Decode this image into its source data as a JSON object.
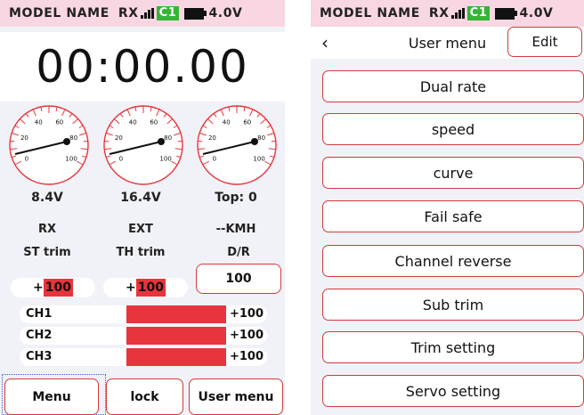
{
  "status": {
    "model_name": "MODEL NAME",
    "rx": "RX",
    "channel_badge": "C1",
    "voltage": "4.0V",
    "icons": [
      "signal-bars-icon",
      "battery-icon"
    ]
  },
  "main": {
    "timer": "00:00.00",
    "gauges": [
      {
        "reading": "8.4V",
        "label": "RX",
        "scale": [
          "0",
          "20",
          "40",
          "60",
          "80",
          "100"
        ]
      },
      {
        "reading": "16.4V",
        "label": "EXT",
        "scale": [
          "0",
          "20",
          "40",
          "60",
          "80",
          "100"
        ]
      },
      {
        "reading": "Top: 0",
        "label": "--KMH",
        "scale": [
          "0",
          "20",
          "40",
          "60",
          "80",
          "100"
        ]
      }
    ],
    "trims": {
      "st_label": "ST trim",
      "th_label": "TH trim",
      "dr_label": "D/R",
      "st_sign": "+",
      "st_value": "100",
      "th_sign": "+",
      "th_value": "100",
      "dr_value": "100"
    },
    "channels": [
      {
        "name": "CH1",
        "value": "+100",
        "level": 1.0
      },
      {
        "name": "CH2",
        "value": "+100",
        "level": 1.0
      },
      {
        "name": "CH3",
        "value": "+100",
        "level": 1.0
      }
    ],
    "buttons": {
      "menu": "Menu",
      "lock": "lock",
      "user_menu": "User menu"
    }
  },
  "user_menu": {
    "back_icon": "chevron-left-icon",
    "title": "User menu",
    "edit": "Edit",
    "items": [
      "Dual rate",
      "speed",
      "curve",
      "Fail safe",
      "Channel reverse",
      "Sub trim",
      "Trim setting",
      "Servo setting"
    ]
  },
  "colors": {
    "accent_red": "#e8343c",
    "status_pink": "#f8d7e2",
    "badge_green": "#35b535",
    "background": "#f1f2f7"
  }
}
